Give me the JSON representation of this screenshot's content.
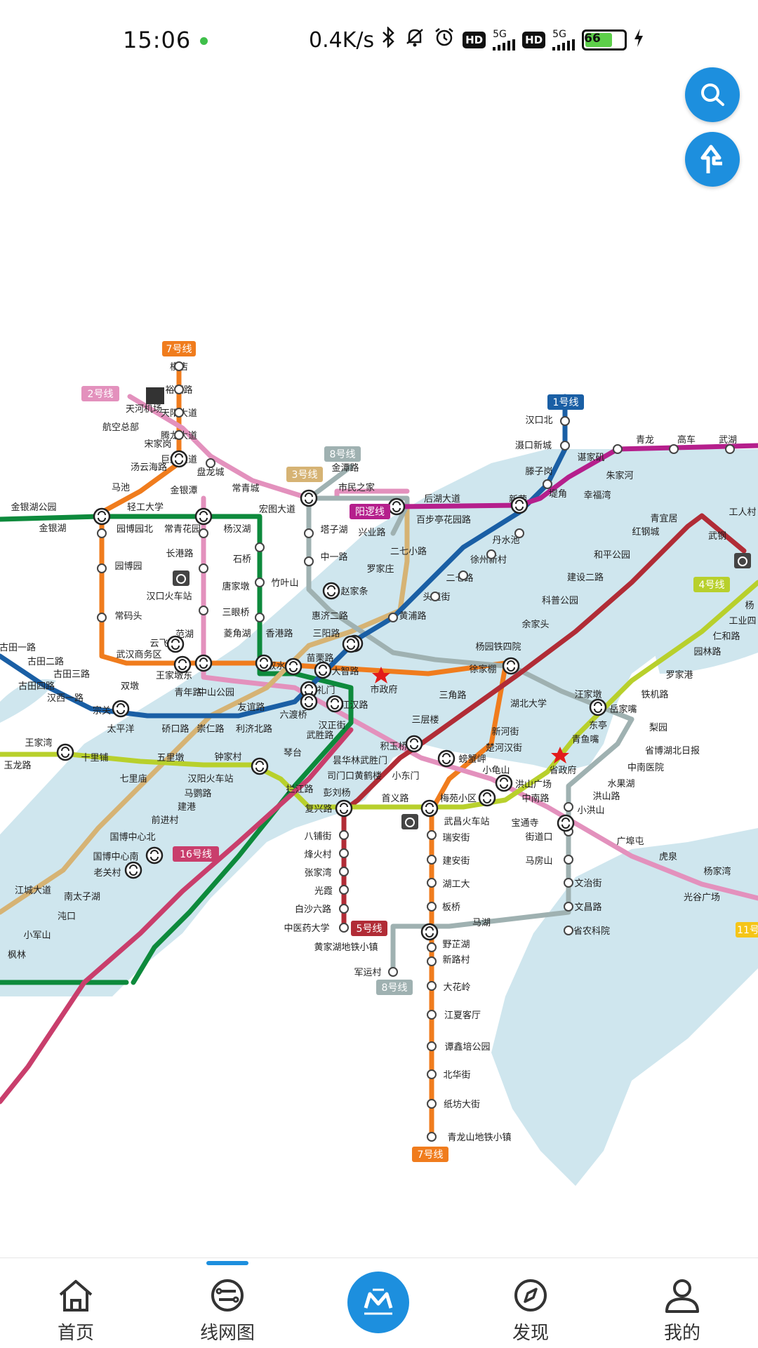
{
  "status_bar": {
    "time": "15:06",
    "net_speed": "0.4K/s",
    "hd1": "HD",
    "net1": "5G",
    "hd2": "HD",
    "net2": "5G",
    "battery_level": "66"
  },
  "icons": {
    "search": "search-icon",
    "route": "route-icon"
  },
  "map": {
    "line_labels": {
      "l7_top": "7号线",
      "l2": "2号线",
      "l8_top": "8号线",
      "l3": "3号线",
      "lyl": "阳逻线",
      "l1": "1号线",
      "l4": "4号线",
      "l16": "16号线",
      "l5": "5号线",
      "l8_bot": "8号线",
      "l7_bot": "7号线",
      "l11": "11号"
    },
    "colors": {
      "line1": "#1a5fa5",
      "line2": "#e391bd",
      "line3": "#d6b374",
      "line4": "#b8d02c",
      "line5": "#b12c36",
      "line6": "#0d8a3c",
      "line7": "#f07c1d",
      "line8": "#9fb1b1",
      "line16": "#c93e6c",
      "lineyl": "#b51f8c",
      "water": "#cfe6ee",
      "line11": "#f5c518"
    },
    "stations": {
      "s_hengdian": "横店",
      "s_yufulu": "裕福路",
      "s_tianyang": "天阳大道",
      "s_tenglong": "腾龙大道",
      "s_julong": "巨龙大道",
      "s_panlong": "盘龙城",
      "s_jintanlu": "金潭路",
      "s_shiminzhijia": "市民之家",
      "s_houhu": "后湖大道",
      "s_baibuting": "百步亭花园路",
      "s_tianhe": "天河机场",
      "s_hangkong": "航空总部",
      "s_songjiagang": "宋家岗",
      "s_tangyun": "汤云海路",
      "s_jinyintan": "金银潭",
      "s_machi": "马池",
      "s_qinggong": "轻工大学",
      "s_jinyinhu_park": "金银湖公园",
      "s_jinyinhu": "金银湖",
      "s_yuanboyuan_n": "园博园北",
      "s_changqinghuayuan": "常青花园",
      "s_changqingcheng": "常青城",
      "s_hongtu": "宏图大道",
      "s_yanghanhu": "杨汉湖",
      "s_changganglu": "长港路",
      "s_yuanboyuan": "园博园",
      "s_hankou_rail": "汉口火车站",
      "s_changmaju": "常码头",
      "s_shiqiao": "石桥",
      "s_tangjiadun": "唐家墩",
      "s_sanyanqiao": "三眼桥",
      "s_zhuyeshan": "竹叶山",
      "s_tazihu": "塔子湖",
      "s_xingyelu": "兴业路",
      "s_zhongyilu": "中一路",
      "s_luojiazhuang": "罗家庄",
      "s_erqixiaolu": "二七小路",
      "s_erqilu": "二七路",
      "s_zhaojiatiao": "赵家条",
      "s_huijisanlu": "惠济二路",
      "s_huangpulu": "黄浦路",
      "s_toudaojie": "头道街",
      "s_xuzhou": "徐州新村",
      "s_danshuichi": "丹水池",
      "s_xinrong": "新荣",
      "s_dijiao": "堤角",
      "s_xingfuwan": "幸福湾",
      "s_zhujiahe": "朱家河",
      "s_xiejiaji": "谌家矶",
      "s_tengzigang": "滕子岗",
      "s_hankoubei": "汉口北",
      "s_dikouxincheng": "滠口新城",
      "s_qinglong": "青龙",
      "s_gaoche": "高车",
      "s_wuhu": "武湖",
      "s_fanhu": "范湖",
      "s_yunfeilu": "云飞路",
      "s_wuhanshangwu": "武汉商务区",
      "s_lingjiaohu": "菱角湖",
      "s_xianggang": "香港路",
      "s_sanyanglu": "三阳路",
      "s_gutian1": "古田一路",
      "s_gutian2": "古田二路",
      "s_gutian3": "古田三路",
      "s_gutian4": "古田四路",
      "s_hanxi": "汉西一路",
      "s_zongguan": "宗关",
      "s_taipingyang": "太平洋",
      "s_qiaokou": "硚口路",
      "s_chongren": "崇仁路",
      "s_lijibei": "利济北路",
      "s_youyilu": "友谊路",
      "s_zhongshanpark": "中山公园",
      "s_qingnianlu": "青年路",
      "s_wangjiadundong": "王家墩东",
      "s_shuangdun": "双墩",
      "s_qushuilou": "取水楼",
      "s_miaolilu": "苗栗路",
      "s_dazhilu": "大智路",
      "s_xunlimen": "循礼门",
      "s_jianghanlu": "江汉路",
      "s_liuduqiao": "六渡桥",
      "s_hanzhengjie": "汉正街",
      "s_wushenglu": "武胜路",
      "s_shizhengfu": "市政府",
      "s_yangyuantie": "杨园铁四院",
      "s_xujiapeng": "徐家棚",
      "s_sanjiaolu": "三角路",
      "s_hubeiuniv": "湖北大学",
      "s_xinhejie": "新河街",
      "s_chuhehan": "楚河汉街",
      "s_pangxiejia": "螃蟹岬",
      "s_xiaoguishan": "小龟山",
      "s_hongshan": "洪山广场",
      "s_zhongnan": "中南路",
      "s_baotong": "宝通寺",
      "s_jiedaokou": "街道口",
      "s_guangbutun": "广埠屯",
      "s_huquan": "虎泉",
      "s_yangjiawan": "杨家湾",
      "s_guanggu": "光谷广场",
      "s_luojiadun": "罗家港",
      "s_tieji": "铁机路",
      "s_wangjiadun": "汪家墩",
      "s_yuejiazui": "岳家嘴",
      "s_dongting": "东亭",
      "s_qingyuzui": "青鱼嘴",
      "s_shengzhengfu": "省政府",
      "s_shengbo": "省博湖北日报",
      "s_zhongnanyiyuan": "中南医院",
      "s_shuiguohu": "水果湖",
      "s_hongshanlu": "洪山路",
      "s_xiaohongshan": "小洪山",
      "s_lishan": "梨园",
      "s_shengnongkeyuan": "省农科院",
      "s_wenchanglu": "文昌路",
      "s_wenzhijie": "文治街",
      "s_mafangshan": "马房山",
      "s_qingyiju": "青宜居",
      "s_hongganglcheng": "红钢城",
      "s_wugang": "武钢",
      "s_heping": "和平公园",
      "s_jianshe2": "建设二路",
      "s_kepu": "科普公园",
      "s_yujiatou": "余家头",
      "s_gongrencun": "工人村",
      "s_renhelu": "仁和路",
      "s_yuanlinlu": "园林路",
      "s_gongyesi": "工业四",
      "s_yangyang": "杨",
      "s_sancenglou": "三层楼",
      "s_jiyuqiao": "积玉桥",
      "s_wuchangshengli": "昙华林武胜门",
      "s_simenkou": "司门口黄鹤楼",
      "s_xiaodongmen": "小东门",
      "s_pengliuyang": "彭刘杨",
      "s_fuxinglu": "复兴路",
      "s_shouyilu": "首义路",
      "s_meiyuan": "梅苑小区",
      "s_wuchang_rail": "武昌火车站",
      "s_ruianjie": "瑞安街",
      "s_jiananjie": "建安街",
      "s_hugongda": "湖工大",
      "s_banqiao": "板桥",
      "s_yezhihu": "野芷湖",
      "s_xinlucun": "新路村",
      "s_dahualing": "大花岭",
      "s_jiangxiakeyun": "江夏客厅",
      "s_tanxinpei": "谭鑫培公园",
      "s_beihua": "北华街",
      "s_zhifang": "纸坊大街",
      "s_qinglongshan": "青龙山地铁小镇",
      "s_mahu": "马湖",
      "s_huangjiahu": "黄家湖地铁小镇",
      "s_junyun": "军运村",
      "s_bapu": "八铺街",
      "s_fenghuo": "烽火村",
      "s_zhangjiawan": "张家湾",
      "s_guangxia": "光霞",
      "s_baishazhou": "白沙六路",
      "s_zhongyiyao": "中医药大学",
      "s_lanjianglu": "拦江路",
      "s_qintai": "琴台",
      "s_zhongjiacun": "钟家村",
      "s_hanyang_rail": "汉阳火车站",
      "s_mayingu": "马鹦路",
      "s_jiangang": "建港",
      "s_qianjincun": "前进村",
      "s_guobozhongxinbei": "国博中心北",
      "s_guobozhongxinnan": "国博中心南",
      "s_laoguan": "老关村",
      "s_jiangcheng": "江城大道",
      "s_nantaizihu": "南太子湖",
      "s_kouhe": "沌口",
      "s_xiaojunshan": "小军山",
      "s_fenglin": "枫林",
      "s_wangjiawan": "王家湾",
      "s_shilipu": "十里铺",
      "s_wulidun": "五里墩",
      "s_qilimiao": "七里庙",
      "s_yulonglu": "玉龙路"
    }
  },
  "tabbar": {
    "home_label": "首页",
    "network_label": "线网图",
    "discover_label": "发现",
    "mine_label": "我的"
  }
}
